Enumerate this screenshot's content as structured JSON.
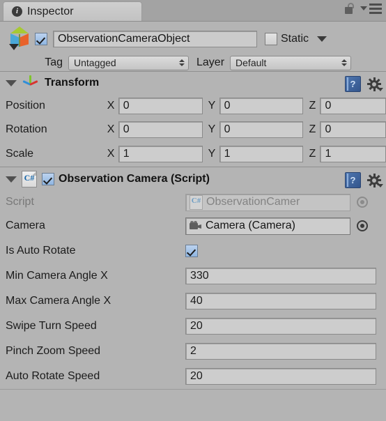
{
  "window": {
    "tab_label": "Inspector",
    "tab_icon": "info-circle-icon",
    "lock_icon": "unlocked-padlock-icon",
    "menu_icon": "hamburger-menu-icon"
  },
  "object_header": {
    "prefab_icon": "gameobject-cube-icon",
    "enabled_checked": true,
    "name": "ObservationCameraObject",
    "static_label": "Static",
    "static_checked": false,
    "tag_label": "Tag",
    "tag_value": "Untagged",
    "layer_label": "Layer",
    "layer_value": "Default"
  },
  "components": [
    {
      "title": "Transform",
      "icon": "transform-axis-gizmo-icon",
      "expanded": true,
      "help_icon": "help-book-icon",
      "settings_icon": "gear-icon",
      "rows": [
        {
          "label": "Position",
          "axes": [
            {
              "axis": "X",
              "value": "0"
            },
            {
              "axis": "Y",
              "value": "0"
            },
            {
              "axis": "Z",
              "value": "0"
            }
          ]
        },
        {
          "label": "Rotation",
          "axes": [
            {
              "axis": "X",
              "value": "0"
            },
            {
              "axis": "Y",
              "value": "0"
            },
            {
              "axis": "Z",
              "value": "0"
            }
          ]
        },
        {
          "label": "Scale",
          "axes": [
            {
              "axis": "X",
              "value": "1"
            },
            {
              "axis": "Y",
              "value": "1"
            },
            {
              "axis": "Z",
              "value": "1"
            }
          ]
        }
      ]
    },
    {
      "title": "Observation Camera (Script)",
      "icon": "csharp-script-icon",
      "expanded": true,
      "enabled_checked": true,
      "help_icon": "help-book-icon",
      "settings_icon": "gear-icon",
      "properties": [
        {
          "label": "Script",
          "type": "object",
          "value": "ObservationCamer",
          "icon": "csharp-script-icon",
          "disabled": true
        },
        {
          "label": "Camera",
          "type": "object",
          "value": "Camera (Camera)",
          "icon": "camera-icon",
          "disabled": false
        },
        {
          "label": "Is Auto Rotate",
          "type": "checkbox",
          "checked": true
        },
        {
          "label": "Min Camera Angle X",
          "type": "number",
          "value": "330"
        },
        {
          "label": "Max Camera Angle X",
          "type": "number",
          "value": "40"
        },
        {
          "label": "Swipe Turn Speed",
          "type": "number",
          "value": "20"
        },
        {
          "label": "Pinch Zoom Speed",
          "type": "number",
          "value": "2"
        },
        {
          "label": "Auto Rotate Speed",
          "type": "number",
          "value": "20"
        }
      ]
    }
  ],
  "colors": {
    "panel_bg": "#b4b4b4",
    "tabbar_bg": "#a3a3a3",
    "field_bg": "#cdcdcd",
    "accent_blue": "#8fb6e2"
  }
}
